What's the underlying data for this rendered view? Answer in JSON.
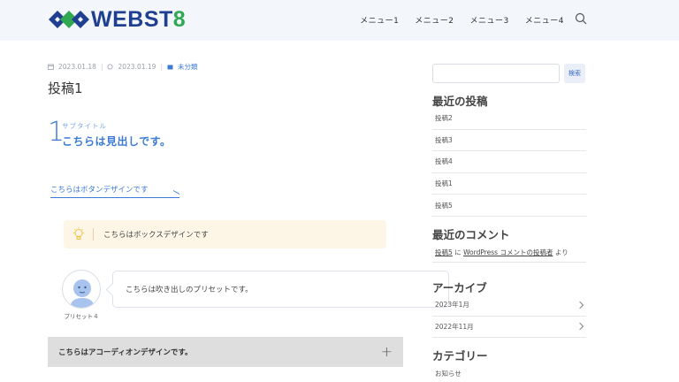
{
  "header": {
    "logo_main": "WEBST",
    "logo_accent": "8",
    "nav": [
      "メニュー1",
      "メニュー2",
      "メニュー3",
      "メニュー4"
    ]
  },
  "post": {
    "published": "2023.01.18",
    "updated": "2023.01.19",
    "category": "未分類",
    "title": "投稿1",
    "heading_number": "1",
    "heading_sub": "サブタイトル",
    "heading_main": "こちらは見出しです。",
    "button_label": "こちらはボタンデザインです",
    "box_text": "こちらはボックスデザインです",
    "balloon_name": "プリセット４",
    "balloon_text": "こちらは吹き出しのプリセットです。",
    "accordion_text": "こちらはアコーディオンデザインです。"
  },
  "sidebar": {
    "search_button": "検索",
    "recent_posts_title": "最近の投稿",
    "recent_posts": [
      "投稿2",
      "投稿3",
      "投稿4",
      "投稿1",
      "投稿5"
    ],
    "recent_comments_title": "最近のコメント",
    "comment": {
      "post_link": "投稿5",
      "on_text": "に",
      "author_link": "WordPress コメントの投稿者",
      "from_text": "より"
    },
    "archives_title": "アーカイブ",
    "archives": [
      "2023年1月",
      "2022年11月"
    ],
    "categories_title": "カテゴリー",
    "categories": [
      "お知らせ"
    ]
  },
  "colors": {
    "brand_blue": "#1f3f90",
    "brand_green": "#2fa84f",
    "accent": "#3b7bd6",
    "header_bg": "#f3f6fb",
    "box_bg": "#fdf6e7",
    "accordion_bg": "#dedede"
  }
}
